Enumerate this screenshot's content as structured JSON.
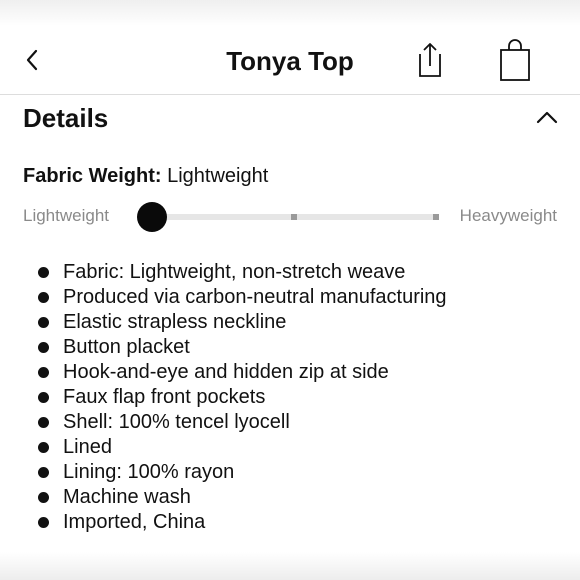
{
  "header": {
    "title": "Tonya Top",
    "icons": {
      "back": "chevron-left-icon",
      "share": "share-icon",
      "bag": "shopping-bag-icon"
    }
  },
  "details": {
    "section_title": "Details",
    "toggle_icon": "chevron-up-icon",
    "fabric_weight_label": "Fabric Weight:",
    "fabric_weight_value": "Lightweight",
    "slider": {
      "min_label": "Lightweight",
      "max_label": "Heavyweight",
      "steps": 3,
      "selected_index": 0
    },
    "items": [
      "Fabric: Lightweight, non-stretch weave",
      "Produced via carbon-neutral manufacturing",
      "Elastic strapless neckline",
      "Button placket",
      "Hook-and-eye and hidden zip at side",
      "Faux flap front pockets",
      "Shell: 100% tencel lyocell",
      "Lined",
      "Lining: 100% rayon",
      "Machine wash",
      "Imported, China"
    ]
  }
}
